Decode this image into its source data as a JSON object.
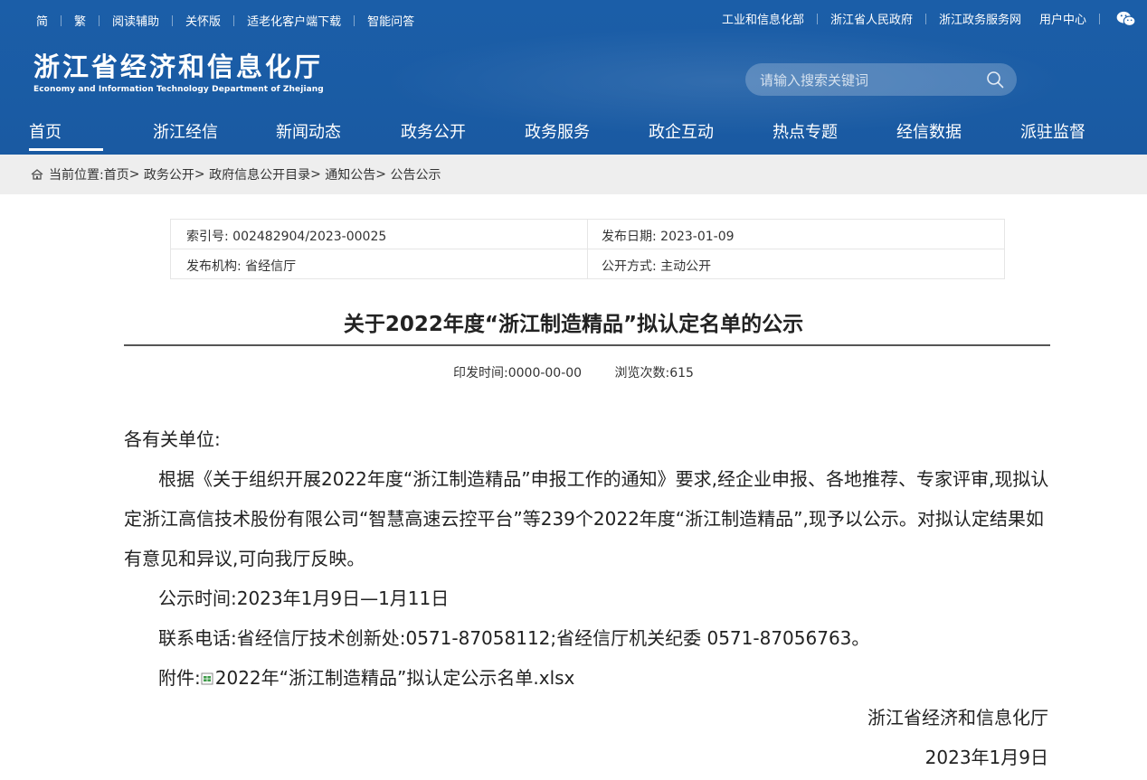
{
  "topbar": {
    "left_links": [
      "简",
      "繁",
      "阅读辅助",
      "关怀版",
      "适老化客户端下载",
      "智能问答"
    ],
    "right_links": [
      "工业和信息化部",
      "浙江省人民政府",
      "浙江政务服务网"
    ],
    "user_center": "用户中心"
  },
  "logo": {
    "cn": "浙江省经济和信息化厅",
    "en": "Economy and Information Technology Department of Zhejiang"
  },
  "search": {
    "placeholder": "请输入搜索关键词"
  },
  "nav": {
    "items": [
      "首页",
      "浙江经信",
      "新闻动态",
      "政务公开",
      "政务服务",
      "政企互动",
      "热点专题",
      "经信数据",
      "派驻监督"
    ],
    "active": "首页"
  },
  "breadcrumb": {
    "prefix": "当前位置:",
    "items": [
      "首页",
      "政务公开",
      "政府信息公开目录",
      "通知公告",
      "公告公示"
    ],
    "separator": ">"
  },
  "meta": {
    "index_label": "索引号: 002482904/2023-00025",
    "date_label": "发布日期: 2023-01-09",
    "org_label": "发布机构: 省经信厅",
    "method_label": "公开方式: 主动公开"
  },
  "article": {
    "title": "关于2022年度“浙江制造精品”拟认定名单的公示",
    "print_time": "印发时间:0000-00-00",
    "views": "浏览次数:615",
    "salutation": "各有关单位:",
    "para1": "根据《关于组织开展2022年度“浙江制造精品”申报工作的通知》要求,经企业申报、各地推荐、专家评审,现拟认定浙江高信技术股份有限公司“智慧高速云控平台”等239个2022年度“浙江制造精品”,现予以公示。对拟认定结果如有意见和异议,可向我厅反映。",
    "para2": "公示时间:2023年1月9日—1月11日",
    "para3": "联系电话:省经信厅技术创新处:0571-87058112;省经信厅机关纪委 0571-87056763。",
    "attach_label": "附件:",
    "attach_file": "2022年“浙江制造精品”拟认定公示名单.xlsx",
    "sign_org": "浙江省经济和信息化厅",
    "sign_date": "2023年1月9日"
  },
  "colors": {
    "header_bg": "#1b5ea8",
    "breadcrumb_bg": "#eeeeee"
  }
}
